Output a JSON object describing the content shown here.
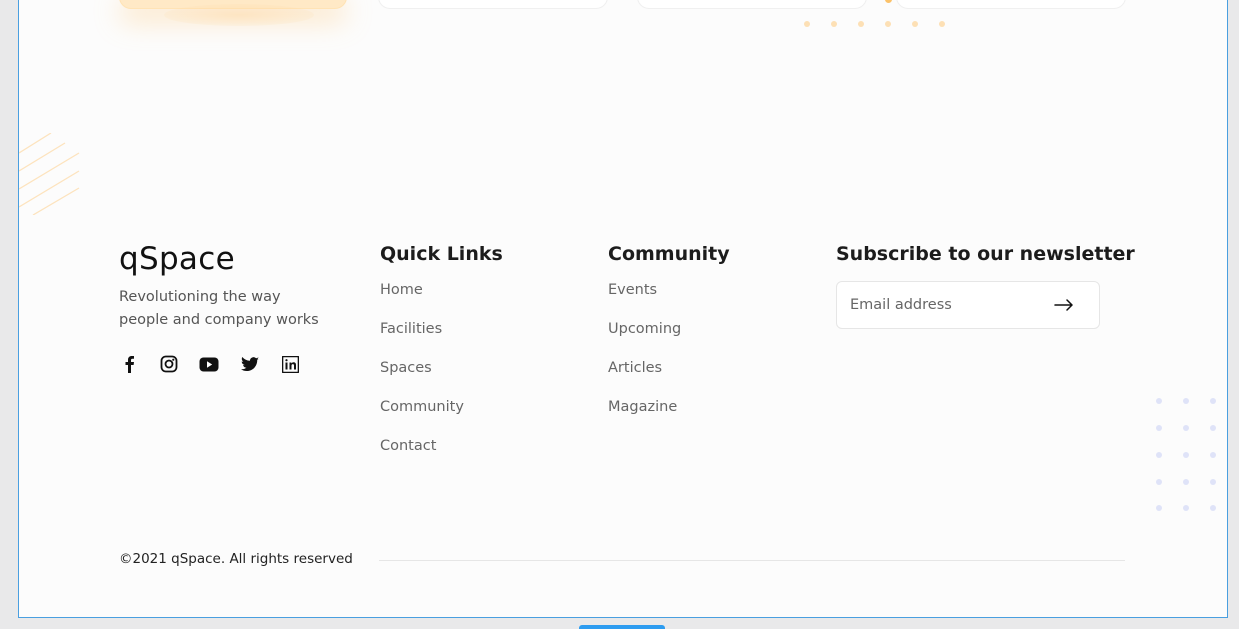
{
  "brand": {
    "logo": "qSpace",
    "tagline": "Revolutioning the way people and company works",
    "socials": [
      "facebook-icon",
      "instagram-icon",
      "youtube-icon",
      "twitter-icon",
      "linkedin-icon"
    ]
  },
  "quick_links": {
    "title": "Quick Links",
    "items": [
      "Home",
      "Facilities",
      "Spaces",
      "Community",
      "Contact"
    ]
  },
  "community": {
    "title": "Community",
    "items": [
      "Events",
      "Upcoming",
      "Articles",
      "Magazine"
    ]
  },
  "newsletter": {
    "title": "Subscribe to our newsletter",
    "placeholder": "Email address",
    "submit_icon": "arrow-right-icon"
  },
  "footer": {
    "copyright": "©2021 qSpace. All rights reserved"
  },
  "colors": {
    "accent_orange": "#fde0b5",
    "frame_border": "#4a9fe0",
    "dot_blue": "#dfe3f8"
  }
}
